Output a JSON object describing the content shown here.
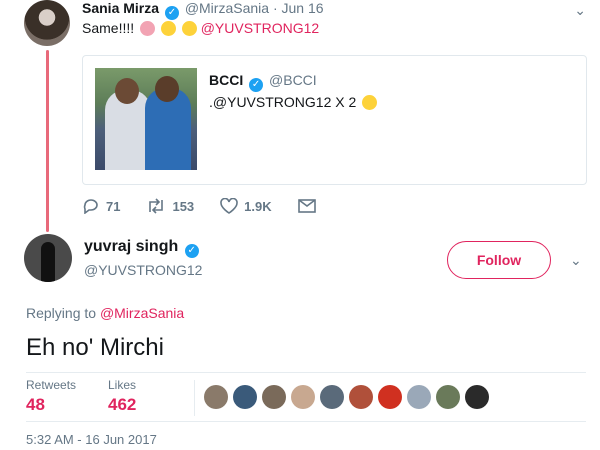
{
  "parent_tweet": {
    "name": "Sania Mirza",
    "handle": "@MirzaSania",
    "separator": "·",
    "date": "Jun 16",
    "text": "Same!!!! ",
    "mention": "@YUVSTRONG12",
    "emojis": [
      "woman-shrugging",
      "face-screaming",
      "joy"
    ],
    "quoted": {
      "name": "BCCI",
      "handle": "@BCCI",
      "text": ".@YUVSTRONG12 X 2 ",
      "emoji": "thinking-face"
    },
    "actions": {
      "replies": "71",
      "retweets": "153",
      "likes": "1.9K"
    }
  },
  "main_tweet": {
    "name": "yuvraj singh",
    "handle": "@YUVSTRONG12",
    "follow_label": "Follow",
    "replying_prefix": "Replying to ",
    "replying_to": "@MirzaSania",
    "text": "Eh no' Mirchi",
    "retweets_label": "Retweets",
    "retweets_count": "48",
    "likes_label": "Likes",
    "likes_count": "462",
    "timestamp": "5:32 AM - 16 Jun 2017"
  },
  "colors": {
    "accent": "#e0245e",
    "verified": "#1da1f2",
    "muted": "#657786",
    "thread": "#e8697a"
  },
  "likers": [
    "#8a7a6a",
    "#3a5a7a",
    "#7a6a5a",
    "#c8a890",
    "#5a6a7a",
    "#b0503a",
    "#d03020",
    "#9aa8b8",
    "#6a7a5a",
    "#2a2a2a"
  ]
}
